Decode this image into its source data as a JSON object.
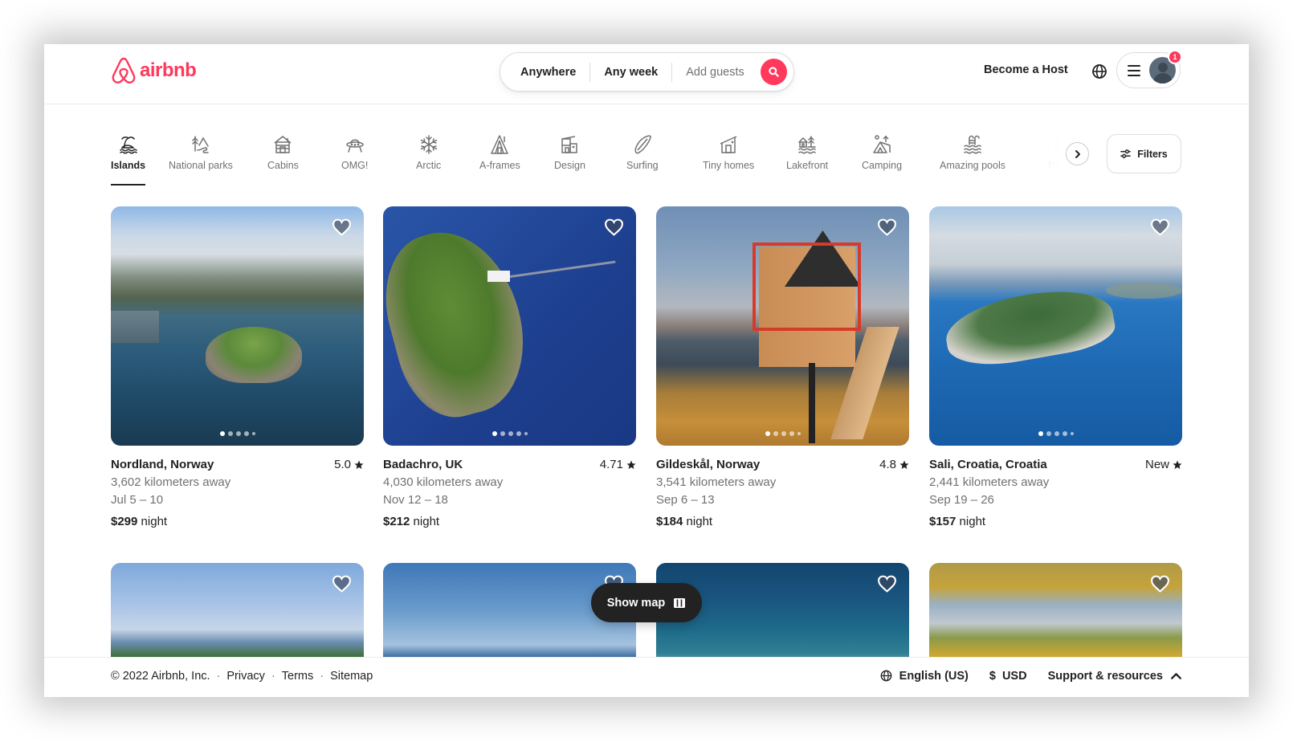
{
  "brand": {
    "name": "airbnb",
    "color": "#ff385c"
  },
  "search": {
    "location": "Anywhere",
    "dates": "Any week",
    "guests_placeholder": "Add guests",
    "search_icon": "search-icon"
  },
  "header_right": {
    "host_label": "Become a Host",
    "language_icon": "globe-icon",
    "menu_icon": "hamburger-menu-icon",
    "notification_count": "1"
  },
  "categories": {
    "items": [
      {
        "label": "Islands",
        "icon": "island-icon",
        "active": true
      },
      {
        "label": "National parks",
        "icon": "national-park-icon"
      },
      {
        "label": "Cabins",
        "icon": "cabin-icon"
      },
      {
        "label": "OMG!",
        "icon": "ufo-icon"
      },
      {
        "label": "Arctic",
        "icon": "snowflake-icon"
      },
      {
        "label": "A-frames",
        "icon": "a-frame-icon"
      },
      {
        "label": "Design",
        "icon": "design-icon"
      },
      {
        "label": "Surfing",
        "icon": "surfboard-icon"
      },
      {
        "label": "Tiny homes",
        "icon": "tiny-home-icon"
      },
      {
        "label": "Lakefront",
        "icon": "lakefront-icon"
      },
      {
        "label": "Camping",
        "icon": "tent-icon"
      },
      {
        "label": "Amazing pools",
        "icon": "pool-icon"
      },
      {
        "label": "Treehouses",
        "visible_label": "Treeho",
        "icon": "treehouse-icon"
      }
    ],
    "filters_label": "Filters"
  },
  "listings": [
    {
      "title": "Nordland, Norway",
      "rating": "5.0",
      "distance": "3,602 kilometers away",
      "dates": "Jul 5 – 10",
      "price": "$299",
      "price_unit": "night",
      "photo_count": 5,
      "active_photo": 1
    },
    {
      "title": "Badachro, UK",
      "rating": "4.71",
      "distance": "4,030 kilometers away",
      "dates": "Nov 12 – 18",
      "price": "$212",
      "price_unit": "night",
      "photo_count": 5,
      "active_photo": 1
    },
    {
      "title": "Gildeskål, Norway",
      "rating": "4.8",
      "distance": "3,541 kilometers away",
      "dates": "Sep 6 – 13",
      "price": "$184",
      "price_unit": "night",
      "photo_count": 5,
      "active_photo": 1
    },
    {
      "title": "Sali, Croatia, Croatia",
      "rating": "New",
      "distance": "2,441 kilometers away",
      "dates": "Sep 19 – 26",
      "price": "$157",
      "price_unit": "night",
      "photo_count": 5,
      "active_photo": 1
    }
  ],
  "show_map": {
    "label": "Show map"
  },
  "footer": {
    "copyright": "© 2022 Airbnb, Inc.",
    "links": [
      "Privacy",
      "Terms",
      "Sitemap"
    ],
    "separator": "·",
    "language": "English (US)",
    "currency_symbol": "$",
    "currency": "USD",
    "support": "Support & resources"
  }
}
